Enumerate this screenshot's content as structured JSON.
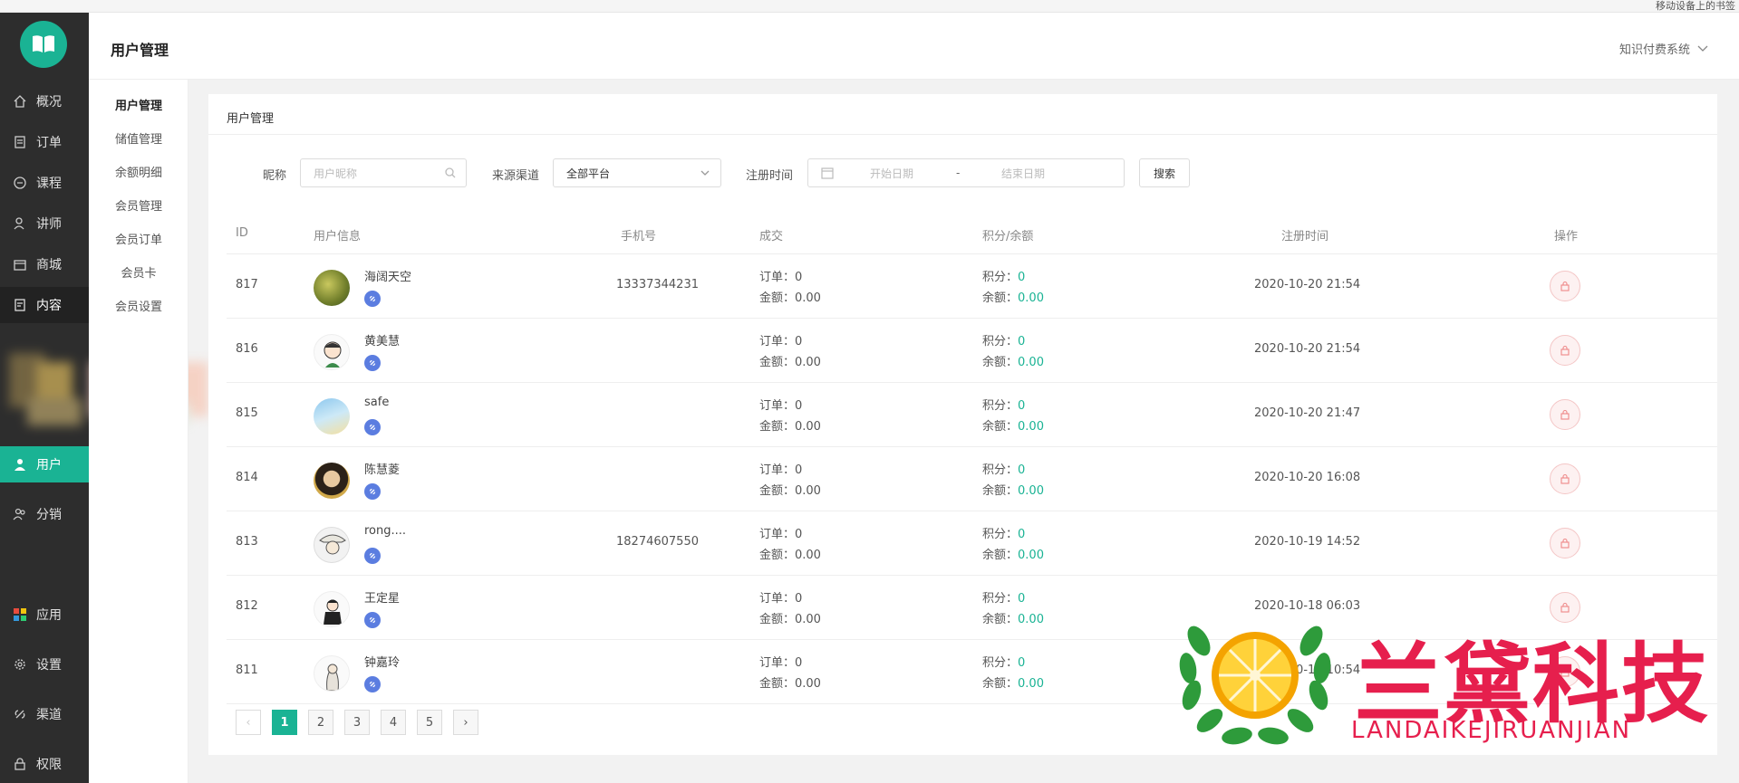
{
  "top_note": "移动设备上的书签",
  "sidebar": {
    "items": [
      {
        "label": "概况",
        "icon": "home-icon"
      },
      {
        "label": "订单",
        "icon": "order-icon"
      },
      {
        "label": "课程",
        "icon": "course-icon"
      },
      {
        "label": "讲师",
        "icon": "teacher-icon"
      },
      {
        "label": "商城",
        "icon": "shop-icon"
      },
      {
        "label": "内容",
        "icon": "content-icon"
      },
      {
        "label": "用户",
        "icon": "user-icon"
      },
      {
        "label": "分销",
        "icon": "distribution-icon"
      },
      {
        "label": "应用",
        "icon": "apps-icon"
      },
      {
        "label": "设置",
        "icon": "settings-icon"
      },
      {
        "label": "渠道",
        "icon": "channel-icon"
      },
      {
        "label": "权限",
        "icon": "lock-icon"
      }
    ]
  },
  "subnav": {
    "items": [
      "用户管理",
      "储值管理",
      "余额明细",
      "会员管理",
      "会员订单",
      "会员卡",
      "会员设置"
    ]
  },
  "header": {
    "title": "用户管理",
    "system": "知识付费系统"
  },
  "panel": {
    "title": "用户管理",
    "filters": {
      "nickname_label": "昵称",
      "nickname_placeholder": "用户昵称",
      "source_label": "来源渠道",
      "source_value": "全部平台",
      "date_label": "注册时间",
      "start_placeholder": "开始日期",
      "separator": "-",
      "end_placeholder": "结束日期",
      "search_button": "搜索"
    },
    "columns": [
      "ID",
      "用户信息",
      "手机号",
      "成交",
      "积分/余额",
      "注册时间",
      "操作"
    ],
    "rows": [
      {
        "id": "817",
        "name": "海阔天空",
        "phone": "13337344231",
        "orders": "订单：0",
        "amount": "金额：0.00",
        "points_label": "积分：",
        "points": "0",
        "balance_label": "余额：",
        "balance": "0.00",
        "date": "2020-10-20 21:54"
      },
      {
        "id": "816",
        "name": "黄美慧",
        "phone": "",
        "orders": "订单：0",
        "amount": "金额：0.00",
        "points_label": "积分：",
        "points": "0",
        "balance_label": "余额：",
        "balance": "0.00",
        "date": "2020-10-20 21:54"
      },
      {
        "id": "815",
        "name": "safe",
        "phone": "",
        "orders": "订单：0",
        "amount": "金额：0.00",
        "points_label": "积分：",
        "points": "0",
        "balance_label": "余额：",
        "balance": "0.00",
        "date": "2020-10-20 21:47"
      },
      {
        "id": "814",
        "name": "陈慧菱",
        "phone": "",
        "orders": "订单：0",
        "amount": "金额：0.00",
        "points_label": "积分：",
        "points": "0",
        "balance_label": "余额：",
        "balance": "0.00",
        "date": "2020-10-20 16:08"
      },
      {
        "id": "813",
        "name": "rong....",
        "phone": "18274607550",
        "orders": "订单：0",
        "amount": "金额：0.00",
        "points_label": "积分：",
        "points": "0",
        "balance_label": "余额：",
        "balance": "0.00",
        "date": "2020-10-19 14:52"
      },
      {
        "id": "812",
        "name": "王定星",
        "phone": "",
        "orders": "订单：0",
        "amount": "金额：0.00",
        "points_label": "积分：",
        "points": "0",
        "balance_label": "余额：",
        "balance": "0.00",
        "date": "2020-10-18 06:03"
      },
      {
        "id": "811",
        "name": "钟嘉玲",
        "phone": "",
        "orders": "订单：0",
        "amount": "金额：0.00",
        "points_label": "积分：",
        "points": "0",
        "balance_label": "余额：",
        "balance": "0.00",
        "date": "2020-10-16 10:54"
      }
    ],
    "pagination": {
      "prev": "‹",
      "pages": [
        "1",
        "2",
        "3",
        "4",
        "5"
      ],
      "current": "1",
      "next": "›"
    }
  },
  "watermark": {
    "title": "兰黛科技",
    "subtitle": "LANDAIKEJIRUANJIAN"
  },
  "colors": {
    "accent": "#1ab394",
    "sidebar_bg": "#2d2d2d",
    "wechat_badge": "#5b7de0",
    "watermark": "#e61f4d"
  }
}
